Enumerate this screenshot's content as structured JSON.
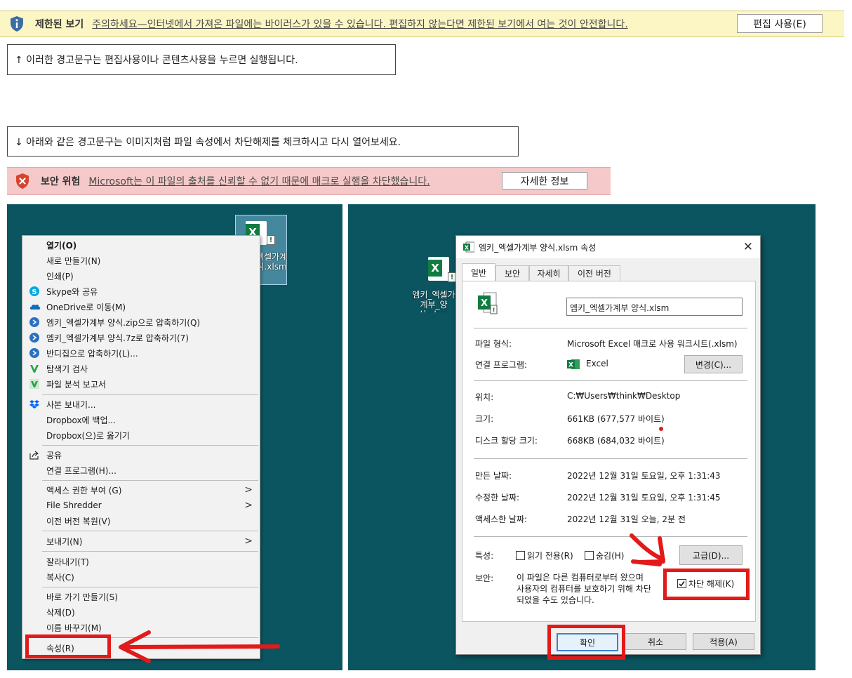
{
  "restricted_bar": {
    "title": "제한된 보기",
    "message": "주의하세요—인터넷에서 가져온 파일에는 바이러스가 있을 수 있습니다. 편집하지 않는다면 제한된 보기에서 여는 것이 안전합니다.",
    "button": "편집 사용(E)",
    "icon": "info-shield-icon",
    "color": "#fbf6c4"
  },
  "note1": "↑ 이러한 경고문구는 편집사용이나 콘텐츠사용을 누르면 실행됩니다.",
  "note2": "↓ 아래와 같은 경고문구는 이미지처럼 파일 속성에서 차단해제를 체크하시고 다시 열어보세요.",
  "security_bar": {
    "title": "보안 위험",
    "message": "Microsoft는 이 파일의 출처를 신뢰할 수 없기 때문에 매크로 실행을 차단했습니다.",
    "button": "자세한 정보",
    "icon": "shield-x-icon",
    "color": "#f5c9c9"
  },
  "desktop": {
    "file_label_left": "엠키_엑셀가계부_양식.xlsm",
    "file_label_right": "엠키_엑셀가계부_양식.xlsm",
    "background": "#0b5561"
  },
  "context_menu": {
    "items": [
      {
        "label": "열기(O)",
        "icon": ""
      },
      {
        "label": "새로 만들기(N)",
        "icon": ""
      },
      {
        "label": "인쇄(P)",
        "icon": ""
      },
      {
        "label": "Skype와 공유",
        "icon": "skype-icon"
      },
      {
        "label": "OneDrive로 이동(M)",
        "icon": "onedrive-icon"
      },
      {
        "label": "엠키_엑셀가계부 양식.zip으로 압축하기(Q)",
        "icon": "bandizip-icon"
      },
      {
        "label": "엠키_엑셀가계부 양식.7z로 압축하기(7)",
        "icon": "bandizip-icon"
      },
      {
        "label": "반디집으로 압축하기(L)...",
        "icon": "bandizip-icon"
      },
      {
        "label": "탐색기 검사",
        "icon": "v3-icon"
      },
      {
        "label": "파일 분석 보고서",
        "icon": "v3-report-icon"
      },
      {
        "label": "사본 보내기...",
        "icon": "dropbox-icon"
      },
      {
        "label": "Dropbox에 백업...",
        "icon": ""
      },
      {
        "label": "Dropbox(으)로 옮기기",
        "icon": ""
      },
      {
        "label": "공유",
        "icon": "share-icon"
      },
      {
        "label": "연결 프로그램(H)...",
        "icon": ""
      },
      {
        "label": "액세스 권한 부여 (G)",
        "icon": ""
      },
      {
        "label": "File Shredder",
        "icon": ""
      },
      {
        "label": "이전 버전 복원(V)",
        "icon": ""
      },
      {
        "label": "보내기(N)",
        "icon": ""
      },
      {
        "label": "잘라내기(T)",
        "icon": ""
      },
      {
        "label": "복사(C)",
        "icon": ""
      },
      {
        "label": "바로 가기 만들기(S)",
        "icon": ""
      },
      {
        "label": "삭제(D)",
        "icon": ""
      },
      {
        "label": "이름 바꾸기(M)",
        "icon": ""
      },
      {
        "label": "속성(R)",
        "icon": ""
      }
    ]
  },
  "dialog": {
    "title": "엠키_엑셀가계부 양식.xlsm 속성",
    "tabs": [
      "일반",
      "보안",
      "자세히",
      "이전 버전"
    ],
    "active_tab": "일반",
    "filename": "엠키_엑셀가계부 양식.xlsm",
    "type_label": "파일 형식:",
    "type_value": "Microsoft Excel 매크로 사용 워크시트(.xlsm)",
    "opens_label": "연결 프로그램:",
    "opens_value": "Excel",
    "change_button": "변경(C)...",
    "location_label": "위치:",
    "location_value": "C:₩Users₩think₩Desktop",
    "size_label": "크기:",
    "size_value": "661KB (677,577 바이트)",
    "disk_label": "디스크 할당 크기:",
    "disk_value": "668KB (684,032 바이트)",
    "created_label": "만든 날짜:",
    "created_value": "2022년 12월 31일 토요일, 오후 1:31:43",
    "modified_label": "수정한 날짜:",
    "modified_value": "2022년 12월 31일 토요일, 오후 1:31:45",
    "accessed_label": "액세스한 날짜:",
    "accessed_value": "2022년 12월 31일 오늘, 2분 전",
    "attributes_label": "특성:",
    "readonly_label": "읽기 전용(R)",
    "hidden_label": "숨김(H)",
    "advanced_button": "고급(D)...",
    "security_label": "보안:",
    "security_text_1": "이 파일은 다른 컴퓨터로부터 왔으며",
    "security_text_2": "사용자의 컴퓨터를 보호하기 위해 차단",
    "security_text_3": "되었을 수도 있습니다.",
    "unblock_label": "차단 해제(K)",
    "unblock_checked": true,
    "ok_button": "확인",
    "cancel_button": "취소",
    "apply_button": "적용(A)"
  },
  "annotation_color": "#e21a1a"
}
